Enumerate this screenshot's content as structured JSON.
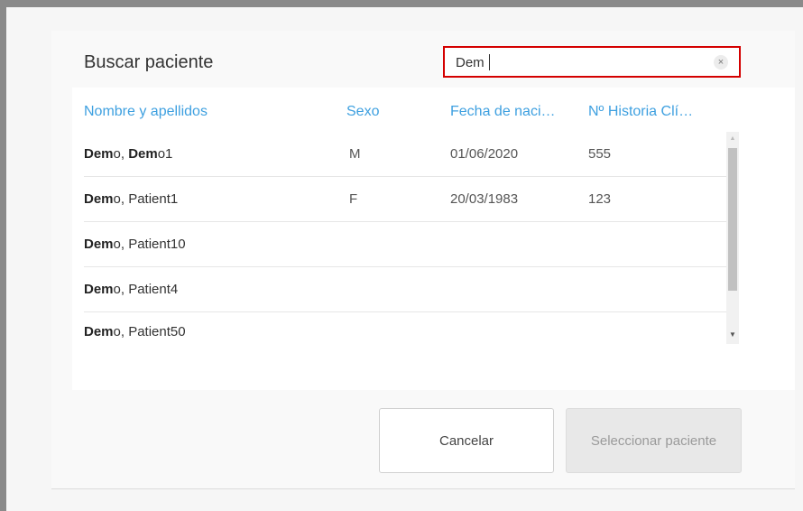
{
  "dialog": {
    "title": "Buscar paciente",
    "search": {
      "value": "Dem",
      "clear_icon": "×"
    },
    "columns": [
      "Nombre y apellidos",
      "Sexo",
      "Fecha de naci…",
      "Nº Historia Clí…"
    ],
    "rows": [
      {
        "name_match": "Dem",
        "name_rest": "o, ",
        "name_match2": "Dem",
        "name_rest2": "o1",
        "sex": "M",
        "dob": "01/06/2020",
        "record": "555"
      },
      {
        "name_match": "Dem",
        "name_rest": "o, Patient1",
        "name_match2": "",
        "name_rest2": "",
        "sex": "F",
        "dob": "20/03/1983",
        "record": "123"
      },
      {
        "name_match": "Dem",
        "name_rest": "o, Patient10",
        "name_match2": "",
        "name_rest2": "",
        "sex": "",
        "dob": "",
        "record": ""
      },
      {
        "name_match": "Dem",
        "name_rest": "o, Patient4",
        "name_match2": "",
        "name_rest2": "",
        "sex": "",
        "dob": "",
        "record": ""
      },
      {
        "name_match": "Dem",
        "name_rest": "o, Patient50",
        "name_match2": "",
        "name_rest2": "",
        "sex": "",
        "dob": "",
        "record": ""
      }
    ],
    "scroll_up_icon": "▲",
    "scroll_down_icon": "▼",
    "cancel_label": "Cancelar",
    "select_label": "Seleccionar paciente"
  },
  "colors": {
    "accent": "#3ea0e0",
    "search_border": "#d40000"
  }
}
